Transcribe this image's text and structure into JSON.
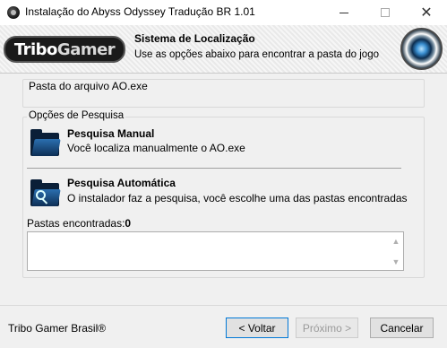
{
  "window": {
    "title": "Instalação do Abyss Odyssey Tradução BR 1.01",
    "icon": "disc-icon",
    "controls": {
      "minimize_icon": "minimize-icon",
      "maximize_icon": "maximize-icon",
      "close_icon": "close-icon",
      "close_glyph": "✕"
    }
  },
  "banner": {
    "logo_text_1": "Tribo",
    "logo_text_2": "Gamer",
    "title": "Sistema de Localização",
    "subtitle": "Use as opções abaixo para encontrar a pasta do jogo",
    "orb_icon": "orb-logo-icon"
  },
  "folder_group": {
    "label": "Pasta do arquivo AO.exe"
  },
  "search_group": {
    "legend": "Opções de Pesquisa",
    "options": [
      {
        "title": "Pesquisa Manual",
        "description": "Você localiza manualmente o AO.exe",
        "icon": "folder-icon"
      },
      {
        "title": "Pesquisa Automática",
        "description": "O instalador faz a pesquisa, você escolhe uma das pastas encontradas",
        "icon": "folder-search-icon"
      }
    ],
    "found_label": "Pastas encontradas:",
    "found_count": "0",
    "scroll_up_glyph": "▲",
    "scroll_down_glyph": "▼"
  },
  "footer": {
    "brand": "Tribo Gamer Brasil®",
    "back_label": "< Voltar",
    "next_label": "Próximo >",
    "cancel_label": "Cancelar"
  }
}
